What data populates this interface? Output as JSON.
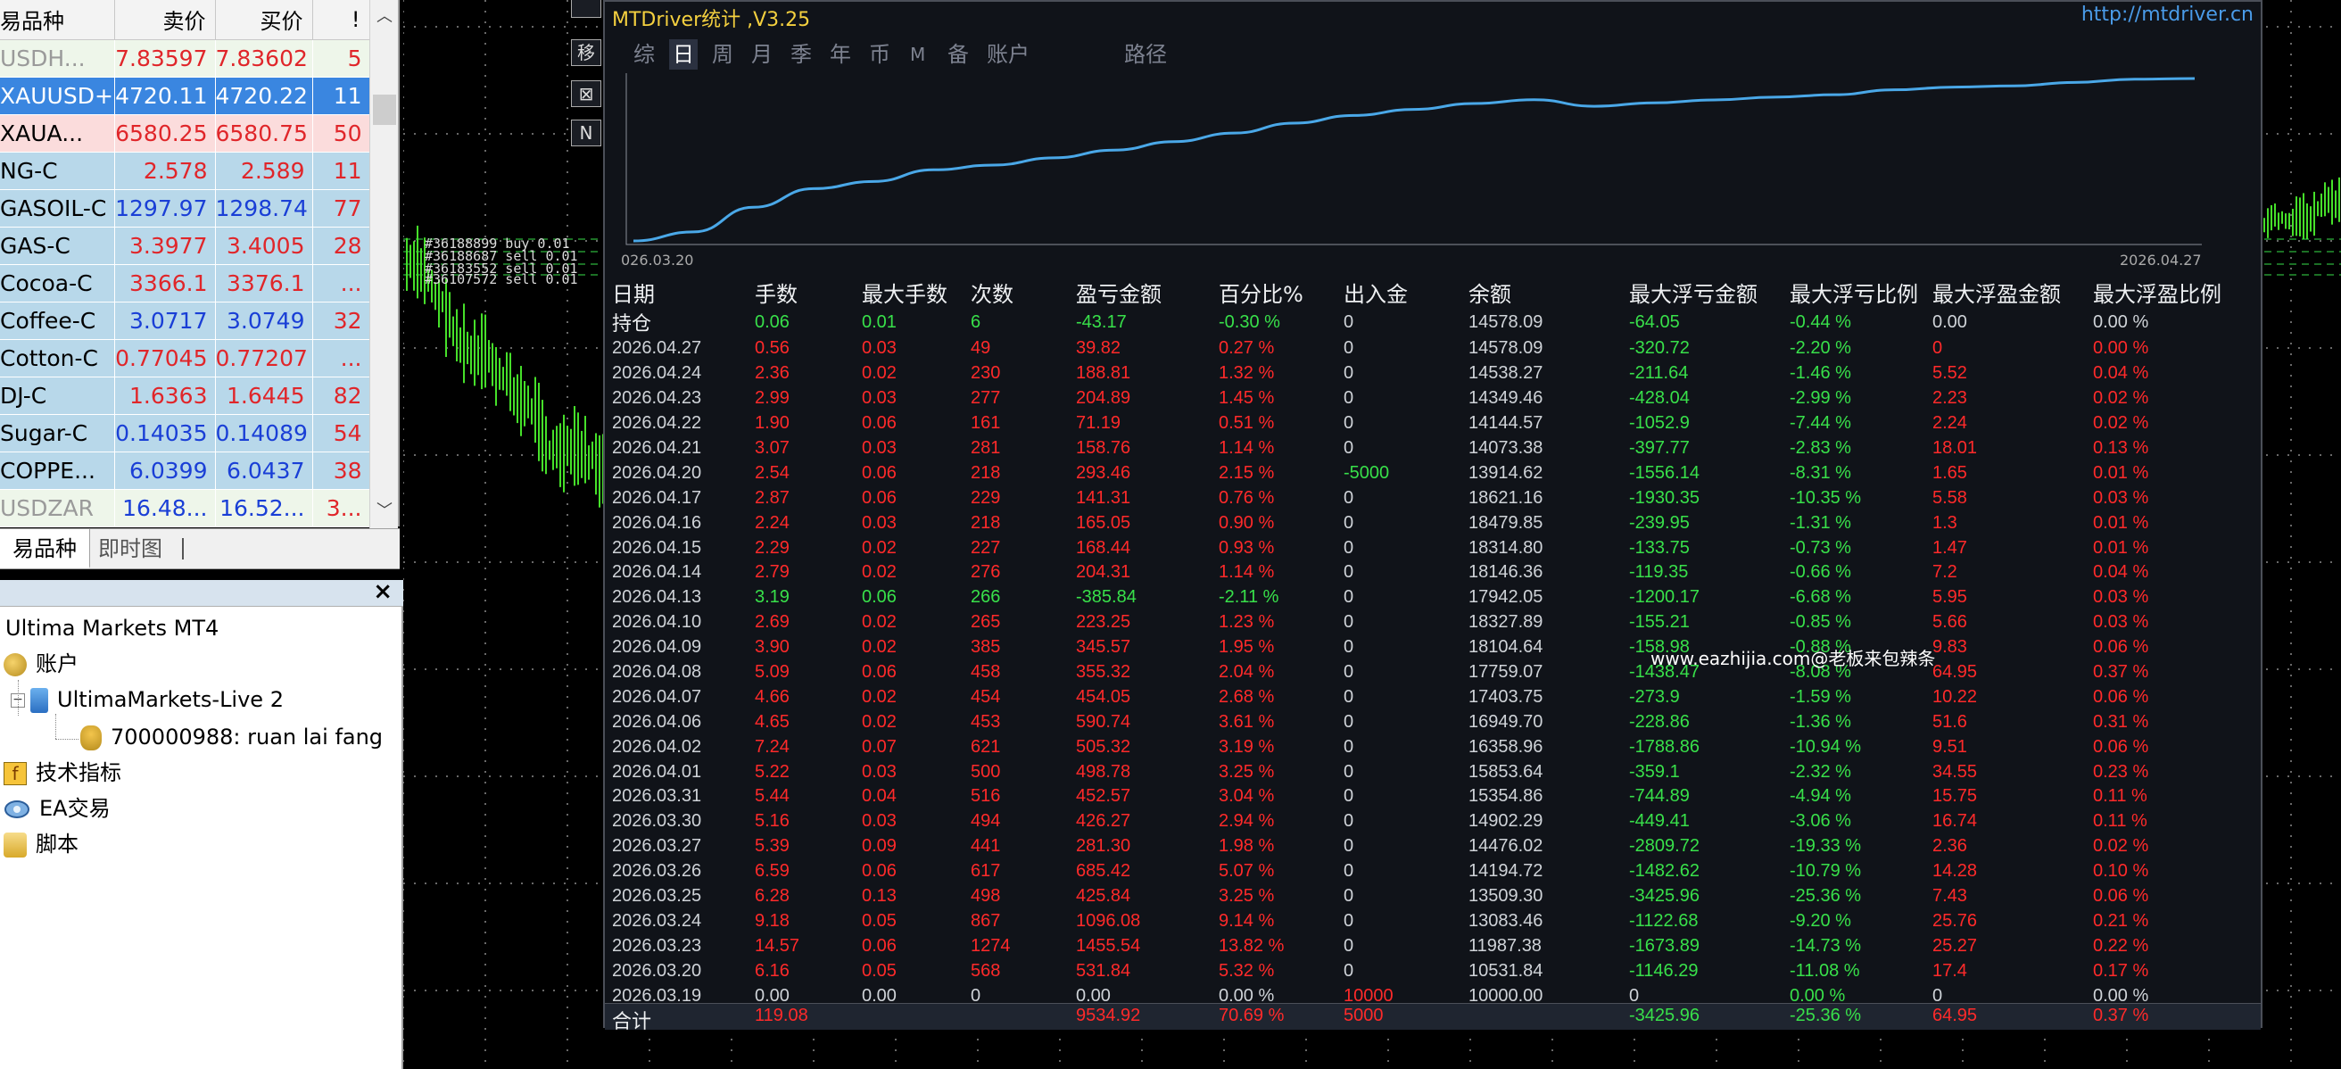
{
  "market_watch": {
    "headers": [
      "易品种",
      "卖价",
      "买价",
      "!"
    ],
    "rows": [
      {
        "symbol": "USDH...",
        "bid": "7.83597",
        "ask": "7.83602",
        "spread": "5",
        "style": "dim",
        "bid_color": "red",
        "ask_color": "red",
        "bg": "light"
      },
      {
        "symbol": "XAUUSD+",
        "bid": "4720.11",
        "ask": "4720.22",
        "spread": "11",
        "style": "sel",
        "bid_color": "white",
        "ask_color": "white",
        "bg": "sel"
      },
      {
        "symbol": "XAUA...",
        "bid": "6580.25",
        "ask": "6580.75",
        "spread": "50",
        "style": "",
        "bid_color": "red",
        "ask_color": "red",
        "bg": "pink"
      },
      {
        "symbol": "NG-C",
        "bid": "2.578",
        "ask": "2.589",
        "spread": "11",
        "style": "",
        "bid_color": "red",
        "ask_color": "red",
        "bg": "blue"
      },
      {
        "symbol": "GASOIL-C",
        "bid": "1297.97",
        "ask": "1298.74",
        "spread": "77",
        "style": "",
        "bid_color": "blue",
        "ask_color": "blue",
        "bg": "blue"
      },
      {
        "symbol": "GAS-C",
        "bid": "3.3977",
        "ask": "3.4005",
        "spread": "28",
        "style": "",
        "bid_color": "red",
        "ask_color": "red",
        "bg": "blue"
      },
      {
        "symbol": "Cocoa-C",
        "bid": "3366.1",
        "ask": "3376.1",
        "spread": "...",
        "style": "",
        "bid_color": "red",
        "ask_color": "red",
        "bg": "blue"
      },
      {
        "symbol": "Coffee-C",
        "bid": "3.0717",
        "ask": "3.0749",
        "spread": "32",
        "style": "",
        "bid_color": "blue",
        "ask_color": "blue",
        "bg": "blue"
      },
      {
        "symbol": "Cotton-C",
        "bid": "0.77045",
        "ask": "0.77207",
        "spread": "...",
        "style": "",
        "bid_color": "red",
        "ask_color": "red",
        "bg": "blue"
      },
      {
        "symbol": "DJ-C",
        "bid": "1.6363",
        "ask": "1.6445",
        "spread": "82",
        "style": "",
        "bid_color": "red",
        "ask_color": "red",
        "bg": "blue"
      },
      {
        "symbol": "Sugar-C",
        "bid": "0.14035",
        "ask": "0.14089",
        "spread": "54",
        "style": "",
        "bid_color": "blue",
        "ask_color": "blue",
        "bg": "blue"
      },
      {
        "symbol": "COPPE...",
        "bid": "6.0399",
        "ask": "6.0437",
        "spread": "38",
        "style": "",
        "bid_color": "blue",
        "ask_color": "blue",
        "bg": "blue"
      },
      {
        "symbol": "USDZAR",
        "bid": "16.48...",
        "ask": "16.52...",
        "spread": "3...",
        "style": "dim",
        "bid_color": "blue",
        "ask_color": "blue",
        "bg": "light"
      }
    ],
    "tabs": [
      "易品种",
      "即时图"
    ]
  },
  "navigator": {
    "close": "×",
    "root": "Ultima Markets MT4",
    "accounts": "账户",
    "server": "UltimaMarkets-Live 2",
    "account": "700000988: ruan lai fang",
    "indicators": "技术指标",
    "experts": "EA交易",
    "scripts": "脚本",
    "ind_glyph": "f"
  },
  "order_labels": [
    "#36188899 buy 0.01",
    "#36188687 sell 0.01",
    "#36183552 sell 0.01",
    "#36107572 sell 0.01"
  ],
  "stats": {
    "title": "MTDriver统计 ,V3.25",
    "url": "http://mtdriver.cn",
    "side_buttons": [
      "移",
      "⊠",
      "N",
      "?"
    ],
    "top_button": "",
    "tabs": [
      "综",
      "日",
      "周",
      "月",
      "季",
      "年",
      "币",
      "M",
      "备",
      "账户",
      "路径"
    ],
    "active_tab": "日",
    "chart": {
      "x_start": "026.03.20",
      "x_end": "2026.04.27",
      "line_color": "#4aa8e8"
    },
    "headers": [
      "日期",
      "手数",
      "最大手数",
      "次数",
      "盈亏金额",
      "百分比%",
      "出入金",
      "余额",
      "最大浮亏金额",
      "最大浮亏比例",
      "最大浮盈金额",
      "最大浮盈比例"
    ],
    "position_row": [
      "持仓",
      "0.06",
      "0.01",
      "6",
      "-43.17",
      "-0.30 %",
      "0",
      "14578.09",
      "-64.05",
      "-0.44 %",
      "0.00",
      "0.00 %"
    ],
    "rows": [
      [
        "2026.04.27",
        "0.56",
        "0.03",
        "49",
        "39.82",
        "0.27 %",
        "0",
        "14578.09",
        "-320.72",
        "-2.20 %",
        "0",
        "0.00 %"
      ],
      [
        "2026.04.24",
        "2.36",
        "0.02",
        "230",
        "188.81",
        "1.32 %",
        "0",
        "14538.27",
        "-211.64",
        "-1.46 %",
        "5.52",
        "0.04 %"
      ],
      [
        "2026.04.23",
        "2.99",
        "0.03",
        "277",
        "204.89",
        "1.45 %",
        "0",
        "14349.46",
        "-428.04",
        "-2.99 %",
        "2.23",
        "0.02 %"
      ],
      [
        "2026.04.22",
        "1.90",
        "0.06",
        "161",
        "71.19",
        "0.51 %",
        "0",
        "14144.57",
        "-1052.9",
        "-7.44 %",
        "2.24",
        "0.02 %"
      ],
      [
        "2026.04.21",
        "3.07",
        "0.03",
        "281",
        "158.76",
        "1.14 %",
        "0",
        "14073.38",
        "-397.77",
        "-2.83 %",
        "18.01",
        "0.13 %"
      ],
      [
        "2026.04.20",
        "2.54",
        "0.06",
        "218",
        "293.46",
        "2.15 %",
        "-5000",
        "13914.62",
        "-1556.14",
        "-8.31 %",
        "1.65",
        "0.01 %"
      ],
      [
        "2026.04.17",
        "2.87",
        "0.06",
        "229",
        "141.31",
        "0.76 %",
        "0",
        "18621.16",
        "-1930.35",
        "-10.35 %",
        "5.58",
        "0.03 %"
      ],
      [
        "2026.04.16",
        "2.24",
        "0.03",
        "218",
        "165.05",
        "0.90 %",
        "0",
        "18479.85",
        "-239.95",
        "-1.31 %",
        "1.3",
        "0.01 %"
      ],
      [
        "2026.04.15",
        "2.29",
        "0.02",
        "227",
        "168.44",
        "0.93 %",
        "0",
        "18314.80",
        "-133.75",
        "-0.73 %",
        "1.47",
        "0.01 %"
      ],
      [
        "2026.04.14",
        "2.79",
        "0.02",
        "276",
        "204.31",
        "1.14 %",
        "0",
        "18146.36",
        "-119.35",
        "-0.66 %",
        "7.2",
        "0.04 %"
      ],
      [
        "2026.04.13",
        "3.19",
        "0.06",
        "266",
        "-385.84",
        "-2.11 %",
        "0",
        "17942.05",
        "-1200.17",
        "-6.68 %",
        "5.95",
        "0.03 %"
      ],
      [
        "2026.04.10",
        "2.69",
        "0.02",
        "265",
        "223.25",
        "1.23 %",
        "0",
        "18327.89",
        "-155.21",
        "-0.85 %",
        "5.66",
        "0.03 %"
      ],
      [
        "2026.04.09",
        "3.90",
        "0.02",
        "385",
        "345.57",
        "1.95 %",
        "0",
        "18104.64",
        "-158.98",
        "-0.88 %",
        "9.83",
        "0.06 %"
      ],
      [
        "2026.04.08",
        "5.09",
        "0.06",
        "458",
        "355.32",
        "2.04 %",
        "0",
        "17759.07",
        "-1438.47",
        "-8.08 %",
        "64.95",
        "0.37 %"
      ],
      [
        "2026.04.07",
        "4.66",
        "0.02",
        "454",
        "454.05",
        "2.68 %",
        "0",
        "17403.75",
        "-273.9",
        "-1.59 %",
        "10.22",
        "0.06 %"
      ],
      [
        "2026.04.06",
        "4.65",
        "0.02",
        "453",
        "590.74",
        "3.61 %",
        "0",
        "16949.70",
        "-228.86",
        "-1.36 %",
        "51.6",
        "0.31 %"
      ],
      [
        "2026.04.02",
        "7.24",
        "0.07",
        "621",
        "505.32",
        "3.19 %",
        "0",
        "16358.96",
        "-1788.86",
        "-10.94 %",
        "9.51",
        "0.06 %"
      ],
      [
        "2026.04.01",
        "5.22",
        "0.03",
        "500",
        "498.78",
        "3.25 %",
        "0",
        "15853.64",
        "-359.1",
        "-2.32 %",
        "34.55",
        "0.23 %"
      ],
      [
        "2026.03.31",
        "5.44",
        "0.04",
        "516",
        "452.57",
        "3.04 %",
        "0",
        "15354.86",
        "-744.89",
        "-4.94 %",
        "15.75",
        "0.11 %"
      ],
      [
        "2026.03.30",
        "5.16",
        "0.03",
        "494",
        "426.27",
        "2.94 %",
        "0",
        "14902.29",
        "-449.41",
        "-3.06 %",
        "16.74",
        "0.11 %"
      ],
      [
        "2026.03.27",
        "5.39",
        "0.09",
        "441",
        "281.30",
        "1.98 %",
        "0",
        "14476.02",
        "-2809.72",
        "-19.33 %",
        "2.36",
        "0.02 %"
      ],
      [
        "2026.03.26",
        "6.59",
        "0.06",
        "617",
        "685.42",
        "5.07 %",
        "0",
        "14194.72",
        "-1482.62",
        "-10.79 %",
        "14.28",
        "0.10 %"
      ],
      [
        "2026.03.25",
        "6.28",
        "0.13",
        "498",
        "425.84",
        "3.25 %",
        "0",
        "13509.30",
        "-3425.96",
        "-25.36 %",
        "7.43",
        "0.06 %"
      ],
      [
        "2026.03.24",
        "9.18",
        "0.05",
        "867",
        "1096.08",
        "9.14 %",
        "0",
        "13083.46",
        "-1122.68",
        "-9.20 %",
        "25.76",
        "0.21 %"
      ],
      [
        "2026.03.23",
        "14.57",
        "0.06",
        "1274",
        "1455.54",
        "13.82 %",
        "0",
        "11987.38",
        "-1673.89",
        "-14.73 %",
        "25.27",
        "0.22 %"
      ],
      [
        "2026.03.20",
        "6.16",
        "0.05",
        "568",
        "531.84",
        "5.32 %",
        "0",
        "10531.84",
        "-1146.29",
        "-11.08 %",
        "17.4",
        "0.17 %"
      ],
      [
        "2026.03.19",
        "0.00",
        "0.00",
        "0",
        "0.00",
        "0.00 %",
        "10000",
        "10000.00",
        "0",
        "0.00 %",
        "0",
        "0.00 %"
      ]
    ],
    "total": {
      "label": "合计",
      "lots": "119.08",
      "pnl": "9534.92",
      "pct": "70.69 %",
      "deposit": "5000",
      "max_dd": "-3425.96",
      "max_dd_pct": "-25.36 %",
      "max_fp": "64.95",
      "max_fp_pct": "0.37 %"
    },
    "watermark": "www.eazhijia.com@老板来包辣条",
    "equity_curve": [
      10000,
      10531.84,
      11987.38,
      13083.46,
      13509.3,
      14194.72,
      14476.02,
      14902.29,
      15354.86,
      15853.64,
      16358.96,
      16949.7,
      17403.75,
      17759.07,
      18104.64,
      18327.89,
      17942.05,
      18146.36,
      18314.8,
      18479.85,
      18621.16,
      18914.62,
      19073.38,
      19144.57,
      19349.46,
      19538.27,
      19578.09
    ]
  }
}
